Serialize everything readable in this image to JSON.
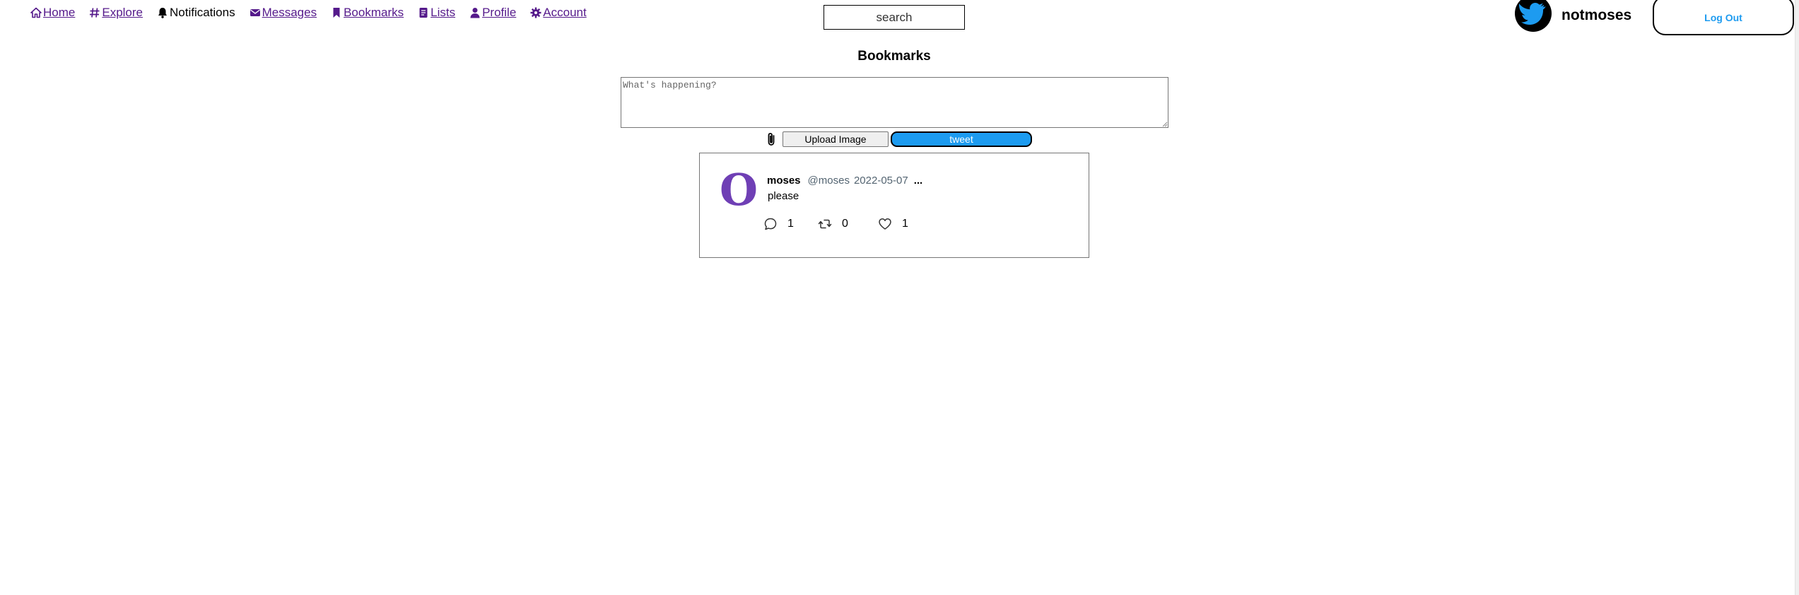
{
  "nav": {
    "items": [
      {
        "label": "Home",
        "icon": "home-icon"
      },
      {
        "label": "Explore",
        "icon": "hashtag-icon"
      },
      {
        "label": "Notifications",
        "icon": "bell-icon"
      },
      {
        "label": "Messages",
        "icon": "envelope-icon"
      },
      {
        "label": "Bookmarks",
        "icon": "bookmark-icon"
      },
      {
        "label": "Lists",
        "icon": "list-icon"
      },
      {
        "label": "Profile",
        "icon": "user-icon"
      },
      {
        "label": "Account",
        "icon": "gear-icon"
      }
    ]
  },
  "search": {
    "placeholder": "search"
  },
  "user": {
    "username": "notmoses",
    "logout_label": "Log Out"
  },
  "page": {
    "title": "Bookmarks"
  },
  "composer": {
    "placeholder": "What's happening?",
    "upload_label": "Upload Image",
    "tweet_label": "tweet"
  },
  "tweet": {
    "avatar_letter": "O",
    "name": "moses",
    "handle": "@moses",
    "date": "2022-05-07",
    "more": "...",
    "text": "please",
    "replies": "1",
    "retweets": "0",
    "likes": "1"
  },
  "colors": {
    "link": "#551a8b",
    "accent": "#1d9bf0",
    "avatar": "#6f3fb5",
    "muted": "#536471"
  }
}
